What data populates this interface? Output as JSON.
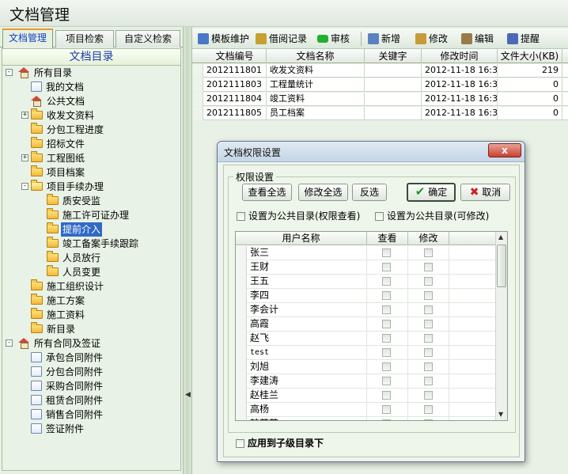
{
  "app": {
    "title": "文档管理"
  },
  "left_tabs": [
    "文档管理",
    "项目检索",
    "自定义检索"
  ],
  "tree": {
    "header": "文档目录",
    "nodes": [
      {
        "label": "所有目录",
        "icon": "home-icon",
        "level": 0,
        "expander": "-"
      },
      {
        "label": "我的文档",
        "icon": "document-icon",
        "level": 1,
        "expander": ""
      },
      {
        "label": "公共文档",
        "icon": "home-icon",
        "level": 1,
        "expander": ""
      },
      {
        "label": "收发文资料",
        "icon": "folder-icon",
        "level": 1,
        "expander": "+"
      },
      {
        "label": "分包工程进度",
        "icon": "folder-icon",
        "level": 1,
        "expander": ""
      },
      {
        "label": "招标文件",
        "icon": "folder-icon",
        "level": 1,
        "expander": ""
      },
      {
        "label": "工程图纸",
        "icon": "folder-icon",
        "level": 1,
        "expander": "+"
      },
      {
        "label": "项目档案",
        "icon": "folder-icon",
        "level": 1,
        "expander": ""
      },
      {
        "label": "项目手续办理",
        "icon": "folder-open-icon",
        "level": 1,
        "expander": "-"
      },
      {
        "label": "质安受监",
        "icon": "folder-icon",
        "level": 2,
        "expander": ""
      },
      {
        "label": "施工许可证办理",
        "icon": "folder-icon",
        "level": 2,
        "expander": ""
      },
      {
        "label": "提前介入",
        "icon": "folder-icon",
        "level": 2,
        "expander": "",
        "selected": true
      },
      {
        "label": "竣工备案手续跟踪",
        "icon": "folder-icon",
        "level": 2,
        "expander": ""
      },
      {
        "label": "人员放行",
        "icon": "folder-icon",
        "level": 2,
        "expander": ""
      },
      {
        "label": "人员变更",
        "icon": "folder-icon",
        "level": 2,
        "expander": ""
      },
      {
        "label": "施工组织设计",
        "icon": "folder-icon",
        "level": 1,
        "expander": ""
      },
      {
        "label": "施工方案",
        "icon": "folder-icon",
        "level": 1,
        "expander": ""
      },
      {
        "label": "施工资料",
        "icon": "folder-icon",
        "level": 1,
        "expander": ""
      },
      {
        "label": "新目录",
        "icon": "folder-icon",
        "level": 1,
        "expander": ""
      },
      {
        "label": "所有合同及签证",
        "icon": "home-icon",
        "level": 0,
        "expander": "-"
      },
      {
        "label": "承包合同附件",
        "icon": "document-icon",
        "level": 1,
        "expander": ""
      },
      {
        "label": "分包合同附件",
        "icon": "document-icon",
        "level": 1,
        "expander": ""
      },
      {
        "label": "采购合同附件",
        "icon": "document-icon",
        "level": 1,
        "expander": ""
      },
      {
        "label": "租赁合同附件",
        "icon": "document-icon",
        "level": 1,
        "expander": ""
      },
      {
        "label": "销售合同附件",
        "icon": "document-icon",
        "level": 1,
        "expander": ""
      },
      {
        "label": "签证附件",
        "icon": "document-icon",
        "level": 1,
        "expander": ""
      }
    ]
  },
  "toolbar": [
    {
      "label": "模板维护",
      "icon": "template-icon",
      "color": "#4a78c8"
    },
    {
      "label": "借阅记录",
      "icon": "borrow-record-icon",
      "color": "#c8a030"
    },
    {
      "label": "审核",
      "icon": "approve-icon",
      "color": "#1fb030"
    },
    {
      "label": "新增",
      "icon": "new-document-icon",
      "color": "#5a82c2"
    },
    {
      "label": "修改",
      "icon": "edit-pen-icon",
      "color": "#c89a3a"
    },
    {
      "label": "编辑",
      "icon": "edit-document-icon",
      "color": "#9a7a4a"
    },
    {
      "label": "提醒",
      "icon": "reminder-icon",
      "color": "#4a6ab8"
    }
  ],
  "grid": {
    "columns": [
      "文档编号",
      "文档名称",
      "关键字",
      "修改时间",
      "文件大小(KB)"
    ],
    "rows": [
      {
        "id": "2012111801",
        "name": "收发文资料",
        "keyword": "",
        "modified": "2012-11-18 16:3",
        "size": "219"
      },
      {
        "id": "2012111803",
        "name": "工程量统计",
        "keyword": "",
        "modified": "2012-11-18 16:3",
        "size": "0"
      },
      {
        "id": "2012111804",
        "name": "竣工资料",
        "keyword": "",
        "modified": "2012-11-18 16:3",
        "size": "0"
      },
      {
        "id": "2012111805",
        "name": "员工档案",
        "keyword": "",
        "modified": "2012-11-18 16:3",
        "size": "0"
      }
    ]
  },
  "dialog": {
    "title": "文档权限设置",
    "close_label": "x",
    "group_label": "权限设置",
    "buttons": {
      "view_all": "查看全选",
      "edit_all": "修改全选",
      "invert": "反选",
      "ok": "确定",
      "cancel": "取消"
    },
    "public_readonly": "设置为公共目录(权限查看)",
    "public_editable": "设置为公共目录(可修改)",
    "apply_sub": "应用到子级目录下",
    "columns": {
      "user": "用户名称",
      "view": "查看",
      "edit": "修改"
    },
    "users": [
      "张三",
      "王财",
      "王五",
      "李四",
      "李会计",
      "高霞",
      "赵飞",
      "test",
      "刘旭",
      "李建涛",
      "赵桂兰",
      "高杨",
      "韩芸芸"
    ]
  }
}
